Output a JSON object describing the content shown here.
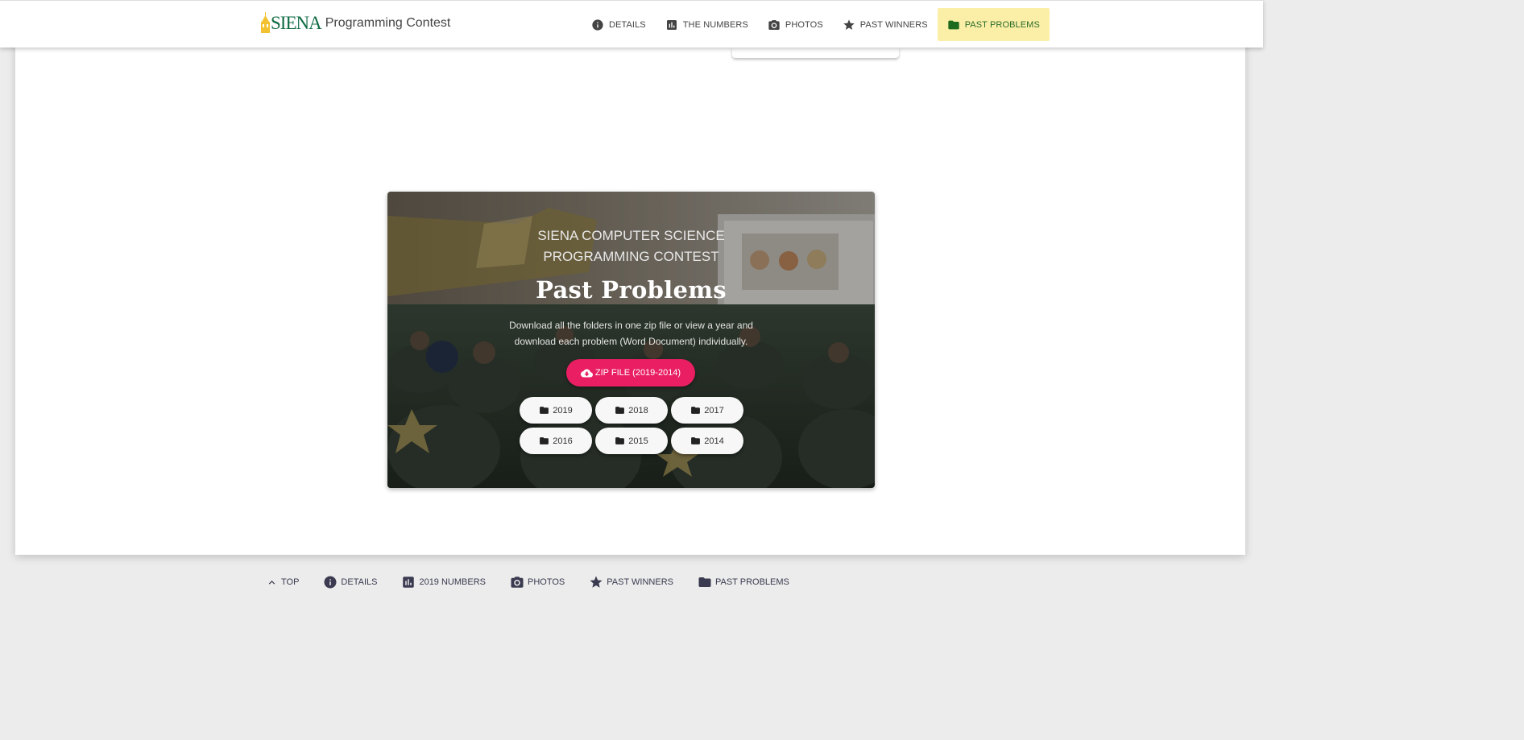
{
  "brand": {
    "logo_text": "SIENA",
    "title": "Programming Contest"
  },
  "nav": {
    "items": [
      {
        "label": "DETAILS",
        "icon": "info-icon"
      },
      {
        "label": "THE NUMBERS",
        "icon": "bar-chart-icon"
      },
      {
        "label": "PHOTOS",
        "icon": "camera-icon"
      },
      {
        "label": "PAST WINNERS",
        "icon": "star-icon"
      },
      {
        "label": "PAST PROBLEMS",
        "icon": "folder-icon",
        "active": true
      }
    ]
  },
  "hero": {
    "eyebrow_line1": "SIENA COMPUTER SCIENCE",
    "eyebrow_line2": "PROGRAMMING CONTEST",
    "title": "Past Problems",
    "description": "Download all the folders in one zip file or view a year and download each problem (Word Document) individually.",
    "zip_button": "ZIP FILE (2019-2014)",
    "years": [
      "2019",
      "2018",
      "2017",
      "2016",
      "2015",
      "2014"
    ]
  },
  "footer": {
    "items": [
      {
        "label": "TOP",
        "icon": "chevron-up-icon"
      },
      {
        "label": "DETAILS",
        "icon": "info-icon"
      },
      {
        "label": "2019 NUMBERS",
        "icon": "bar-chart-icon"
      },
      {
        "label": "PHOTOS",
        "icon": "camera-icon"
      },
      {
        "label": "PAST WINNERS",
        "icon": "star-icon"
      },
      {
        "label": "PAST PROBLEMS",
        "icon": "folder-icon"
      }
    ]
  },
  "colors": {
    "accent": "#e91e63",
    "brand_green": "#106c44",
    "active_nav_bg": "#fbefa7",
    "logo_gold": "#f2c230"
  }
}
